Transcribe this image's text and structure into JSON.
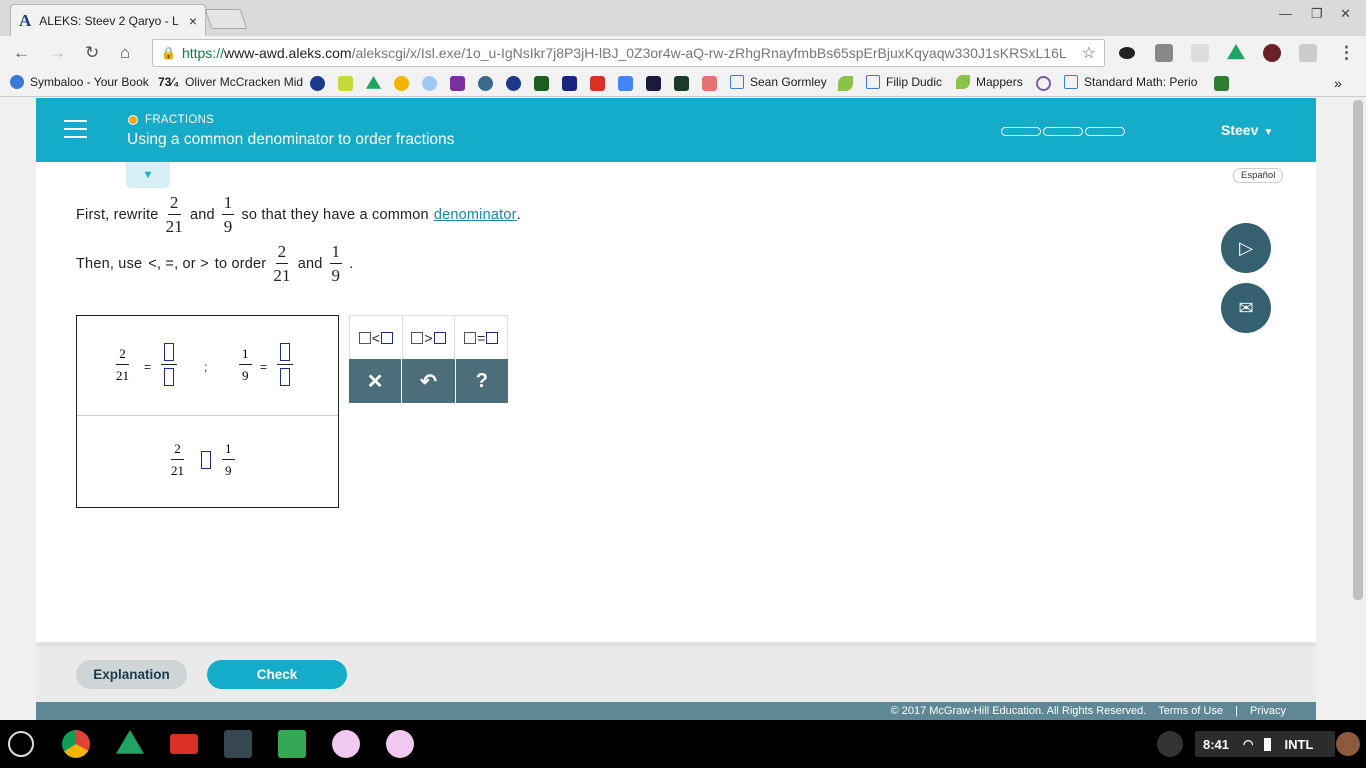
{
  "browser": {
    "tab_title": "ALEKS: Steev 2 Qaryo - L",
    "tab_favicon": "A",
    "tab_close": "×",
    "url_scheme": "https://",
    "url_host": "www-awd.aleks.com",
    "url_path": "/alekscgi/x/Isl.exe/1o_u-IgNsIkr7j8P3jH-lBJ_0Z3or4w-aQ-rw-zRhgRnayfmbBs65spErBjuxKqyaqw330J1sKRSxL16L",
    "back": "←",
    "forward": "→",
    "reload": "↻",
    "home": "⌂",
    "star": "☆",
    "minimize": "—",
    "restore": "❐",
    "close": "✕",
    "menu": "⋮",
    "bookmarks": [
      {
        "label": "Symbaloo - Your Book",
        "color": "#3b7bd6"
      },
      {
        "label": "Oliver McCracken Mid",
        "prefix": "73⁄₄"
      },
      {
        "label": "Sean Gormley",
        "color": "#3b7bd6"
      },
      {
        "label": "Filip Dudic",
        "color": "#3b7bd6"
      },
      {
        "label": "Mappers",
        "color": "#8bc34a"
      },
      {
        "label": "Standard Math: Perio",
        "color": "#3b7bd6"
      }
    ],
    "more_bookmarks": "»"
  },
  "header": {
    "topic": "FRACTIONS",
    "title": "Using a common denominator to order fractions",
    "user": "Steev",
    "user_caret": "▼",
    "dropdown_caret": "▼",
    "language": "Español"
  },
  "problem": {
    "line1_prefix": "First, rewrite",
    "line1_and": "and",
    "line1_suffix": "so that they have a common",
    "line1_link": "denominator",
    "line1_end": ".",
    "line2_prefix": "Then, use",
    "line2_symbols": "<, =, or >",
    "line2_middle": "to order",
    "line2_and": "and",
    "line2_end": ".",
    "frac_a": {
      "num": "2",
      "den": "21"
    },
    "frac_b": {
      "num": "1",
      "den": "9"
    }
  },
  "workarea": {
    "eq_sign": "=",
    "separator": ";"
  },
  "keypad": {
    "lt": "<",
    "gt": ">",
    "eq": "=",
    "clear": "✕",
    "undo": "↶",
    "help": "?"
  },
  "side": {
    "video_icon": "▷",
    "mail_icon": "✉"
  },
  "footer": {
    "explanation": "Explanation",
    "check": "Check",
    "copyright": "© 2017 McGraw-Hill Education. All Rights Reserved.",
    "terms": "Terms of Use",
    "divider": "|",
    "privacy": "Privacy"
  },
  "taskbar": {
    "time": "8:41",
    "locale": "INTL"
  },
  "colors": {
    "accent": "#14acc8",
    "dark_teal": "#34606f",
    "keypad": "#4c6e7b"
  }
}
